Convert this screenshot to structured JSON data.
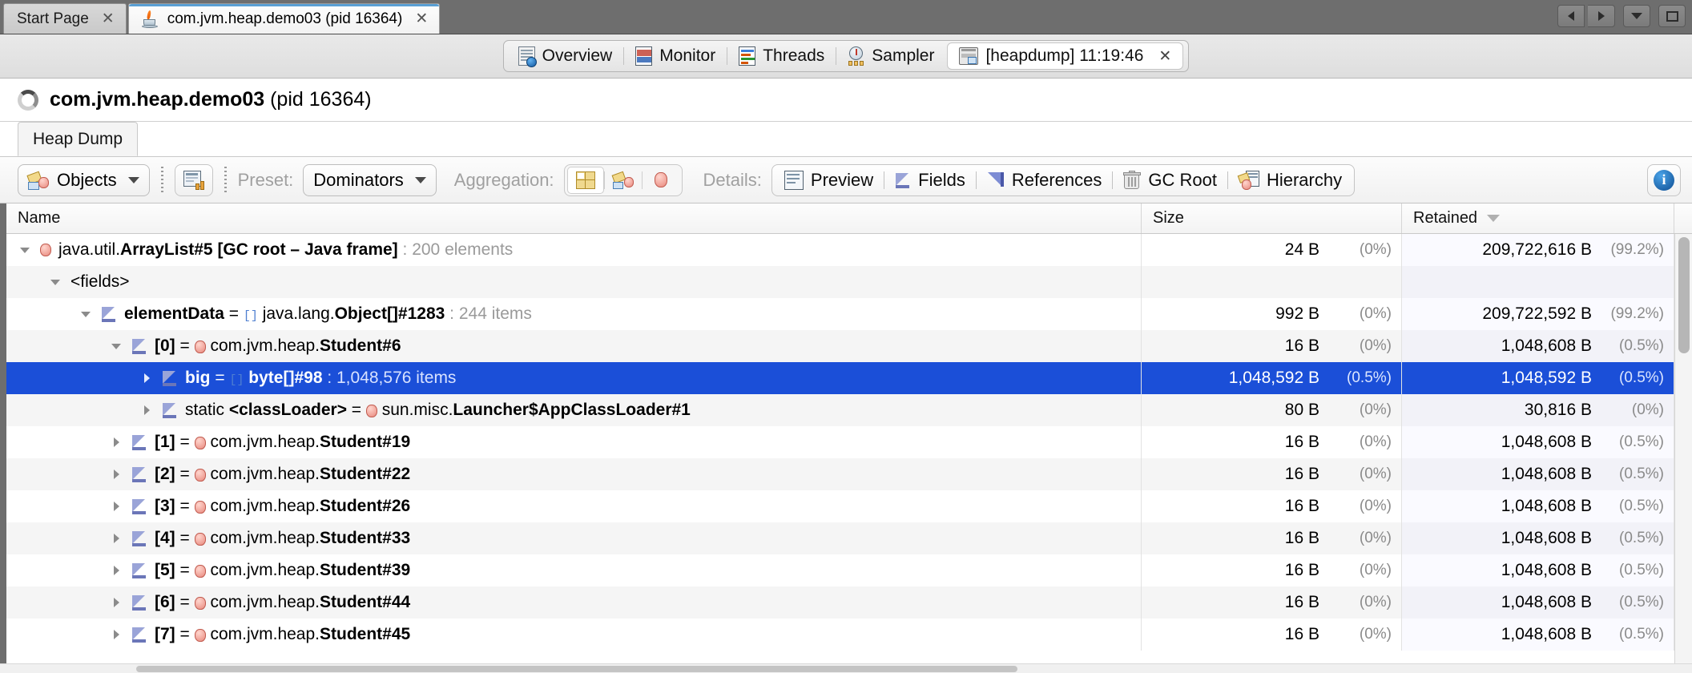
{
  "window": {
    "tabs": [
      {
        "label": "Start Page",
        "icon": "none",
        "active": false,
        "closable": true
      },
      {
        "label": "com.jvm.heap.demo03 (pid 16364)",
        "icon": "java-cup-icon",
        "active": true,
        "closable": true
      }
    ],
    "controls": [
      {
        "name": "nav-back-button",
        "glyph": "left-triangle-icon"
      },
      {
        "name": "nav-forward-button",
        "glyph": "right-triangle-icon"
      },
      {
        "name": "tab-list-dropdown-button",
        "glyph": "chevron-down-icon"
      },
      {
        "name": "maximize-button",
        "glyph": "square-icon"
      }
    ]
  },
  "view_tabs": [
    {
      "label": "Overview",
      "icon": "overview-doc-icon",
      "active": false,
      "closable": false
    },
    {
      "label": "Monitor",
      "icon": "monitor-chart-icon",
      "active": false,
      "closable": false
    },
    {
      "label": "Threads",
      "icon": "threads-icon",
      "active": false,
      "closable": false
    },
    {
      "label": "Sampler",
      "icon": "sampler-gauge-icon",
      "active": false,
      "closable": false
    },
    {
      "label": "[heapdump] 11:19:46",
      "icon": "heapdump-icon",
      "active": true,
      "closable": true
    }
  ],
  "process": {
    "name": "com.jvm.heap.demo03",
    "pid_text": "(pid 16364)",
    "status_icon": "loading-spinner-icon"
  },
  "subtab": {
    "label": "Heap Dump"
  },
  "toolbar": {
    "objects_button": "Objects",
    "compare_icon": "compare-snapshot-icon",
    "preset_label": "Preset:",
    "preset_value": "Dominators",
    "aggregation_label": "Aggregation:",
    "aggregation_options": [
      {
        "name": "aggregation-classes",
        "icon": "grid-classes-icon",
        "selected": true
      },
      {
        "name": "aggregation-packages",
        "icon": "packages-icon",
        "selected": false
      },
      {
        "name": "aggregation-objects",
        "icon": "object-dot-icon",
        "selected": false
      }
    ],
    "details_label": "Details:",
    "details_items": [
      {
        "label": "Preview",
        "icon": "preview-doc-icon"
      },
      {
        "label": "Fields",
        "icon": "fields-arrow-icon"
      },
      {
        "label": "References",
        "icon": "references-arrow-icon"
      },
      {
        "label": "GC Root",
        "icon": "trash-gcroot-icon"
      },
      {
        "label": "Hierarchy",
        "icon": "hierarchy-icon"
      }
    ],
    "info_button": "i"
  },
  "table": {
    "columns": [
      {
        "key": "name",
        "label": "Name",
        "sorted": false
      },
      {
        "key": "size",
        "label": "Size",
        "sorted": false
      },
      {
        "key": "retained",
        "label": "Retained",
        "sorted": true,
        "sort_dir": "desc"
      }
    ],
    "rows": [
      {
        "indent": 0,
        "twisty": "down",
        "icon": "object-dot-icon",
        "prefix": "",
        "plain": "java.util.",
        "bold": "ArrayList#5 [GC root – Java frame]",
        "suffix": " : 200 elements",
        "size": "24 B",
        "size_pct": "(0%)",
        "retained": "209,722,616 B",
        "retained_pct": "(99.2%)",
        "selected": false,
        "alt": false
      },
      {
        "indent": 1,
        "twisty": "down",
        "icon": "none",
        "prefix": "",
        "plain": "<fields>",
        "bold": "",
        "suffix": "",
        "size": "",
        "size_pct": "",
        "retained": "",
        "retained_pct": "",
        "selected": false,
        "alt": true
      },
      {
        "indent": 2,
        "twisty": "down",
        "icon": "fields-arrow-icon",
        "prefix": "",
        "plain": "",
        "bold": "elementData",
        "mid": " = ",
        "arr": "[]",
        "plain2": "java.lang.",
        "bold2": "Object[]#1283",
        "suffix": " : 244 items",
        "size": "992 B",
        "size_pct": "(0%)",
        "retained": "209,722,592 B",
        "retained_pct": "(99.2%)",
        "selected": false,
        "alt": false
      },
      {
        "indent": 3,
        "twisty": "down",
        "icon": "fields-arrow-icon",
        "prefix": "",
        "plain": "",
        "bold": "[0]",
        "mid": " = ",
        "dot": true,
        "plain2": "com.jvm.heap.",
        "bold2": "Student#6",
        "suffix": "",
        "size": "16 B",
        "size_pct": "(0%)",
        "retained": "1,048,608 B",
        "retained_pct": "(0.5%)",
        "selected": false,
        "alt": true
      },
      {
        "indent": 4,
        "twisty": "right",
        "icon": "fields-arrow-icon",
        "prefix": "",
        "plain": "",
        "bold": "big",
        "mid": " = ",
        "arr": "[]",
        "plain2": "",
        "bold2": "byte[]#98",
        "suffix": " : 1,048,576 items",
        "size": "1,048,592 B",
        "size_pct": "(0.5%)",
        "retained": "1,048,592 B",
        "retained_pct": "(0.5%)",
        "selected": true,
        "alt": false
      },
      {
        "indent": 4,
        "twisty": "right",
        "icon": "fields-arrow-icon",
        "prefix": "static ",
        "plain": "",
        "bold": "<classLoader>",
        "mid": " = ",
        "dot": true,
        "plain2": "sun.misc.",
        "bold2": "Launcher$AppClassLoader#1",
        "suffix": "",
        "size": "80 B",
        "size_pct": "(0%)",
        "retained": "30,816 B",
        "retained_pct": "(0%)",
        "selected": false,
        "alt": true
      },
      {
        "indent": 3,
        "twisty": "right",
        "icon": "fields-arrow-icon",
        "prefix": "",
        "plain": "",
        "bold": "[1]",
        "mid": " = ",
        "dot": true,
        "plain2": "com.jvm.heap.",
        "bold2": "Student#19",
        "suffix": "",
        "size": "16 B",
        "size_pct": "(0%)",
        "retained": "1,048,608 B",
        "retained_pct": "(0.5%)",
        "selected": false,
        "alt": false
      },
      {
        "indent": 3,
        "twisty": "right",
        "icon": "fields-arrow-icon",
        "prefix": "",
        "plain": "",
        "bold": "[2]",
        "mid": " = ",
        "dot": true,
        "plain2": "com.jvm.heap.",
        "bold2": "Student#22",
        "suffix": "",
        "size": "16 B",
        "size_pct": "(0%)",
        "retained": "1,048,608 B",
        "retained_pct": "(0.5%)",
        "selected": false,
        "alt": true
      },
      {
        "indent": 3,
        "twisty": "right",
        "icon": "fields-arrow-icon",
        "prefix": "",
        "plain": "",
        "bold": "[3]",
        "mid": " = ",
        "dot": true,
        "plain2": "com.jvm.heap.",
        "bold2": "Student#26",
        "suffix": "",
        "size": "16 B",
        "size_pct": "(0%)",
        "retained": "1,048,608 B",
        "retained_pct": "(0.5%)",
        "selected": false,
        "alt": false
      },
      {
        "indent": 3,
        "twisty": "right",
        "icon": "fields-arrow-icon",
        "prefix": "",
        "plain": "",
        "bold": "[4]",
        "mid": " = ",
        "dot": true,
        "plain2": "com.jvm.heap.",
        "bold2": "Student#33",
        "suffix": "",
        "size": "16 B",
        "size_pct": "(0%)",
        "retained": "1,048,608 B",
        "retained_pct": "(0.5%)",
        "selected": false,
        "alt": true
      },
      {
        "indent": 3,
        "twisty": "right",
        "icon": "fields-arrow-icon",
        "prefix": "",
        "plain": "",
        "bold": "[5]",
        "mid": " = ",
        "dot": true,
        "plain2": "com.jvm.heap.",
        "bold2": "Student#39",
        "suffix": "",
        "size": "16 B",
        "size_pct": "(0%)",
        "retained": "1,048,608 B",
        "retained_pct": "(0.5%)",
        "selected": false,
        "alt": false
      },
      {
        "indent": 3,
        "twisty": "right",
        "icon": "fields-arrow-icon",
        "prefix": "",
        "plain": "",
        "bold": "[6]",
        "mid": " = ",
        "dot": true,
        "plain2": "com.jvm.heap.",
        "bold2": "Student#44",
        "suffix": "",
        "size": "16 B",
        "size_pct": "(0%)",
        "retained": "1,048,608 B",
        "retained_pct": "(0.5%)",
        "selected": false,
        "alt": true
      },
      {
        "indent": 3,
        "twisty": "right",
        "icon": "fields-arrow-icon",
        "prefix": "",
        "plain": "",
        "bold": "[7]",
        "mid": " = ",
        "dot": true,
        "plain2": "com.jvm.heap.",
        "bold2": "Student#45",
        "suffix": "",
        "size": "16 B",
        "size_pct": "(0%)",
        "retained": "1,048,608 B",
        "retained_pct": "(0.5%)",
        "selected": false,
        "alt": false
      }
    ]
  },
  "colors": {
    "selection": "#1b4fd8",
    "window_chrome": "#6e6e6e",
    "active_tab_accent": "#5a9fd4"
  }
}
